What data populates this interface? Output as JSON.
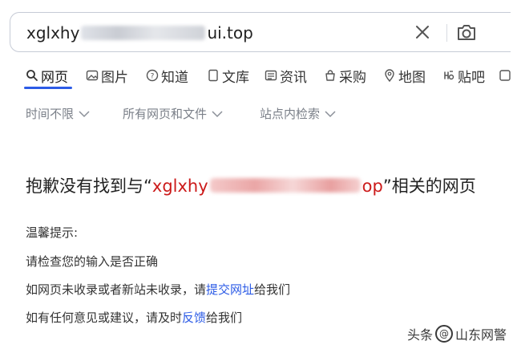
{
  "search": {
    "query_prefix": "xglxhy",
    "query_suffix": "ui.top"
  },
  "tabs": [
    {
      "label": "网页",
      "icon": "search-icon",
      "active": true
    },
    {
      "label": "图片",
      "icon": "image-icon"
    },
    {
      "label": "知道",
      "icon": "question-icon"
    },
    {
      "label": "文库",
      "icon": "document-icon"
    },
    {
      "label": "资讯",
      "icon": "news-icon"
    },
    {
      "label": "采购",
      "icon": "shopping-icon"
    },
    {
      "label": "地图",
      "icon": "map-pin-icon"
    },
    {
      "label": "贴吧",
      "icon": "tieba-icon"
    }
  ],
  "filters": [
    {
      "label": "时间不限"
    },
    {
      "label": "所有网页和文件"
    },
    {
      "label": "站点内检索"
    }
  ],
  "result": {
    "headline_prefix": "抱歉没有找到与“",
    "query_prefix": "xglxhy",
    "query_suffix": "op",
    "headline_suffix": "”相关的网页"
  },
  "tips": {
    "title": "温馨提示:",
    "line1": "请检查您的输入是否正确",
    "line2_prefix": "如网页未收录或者新站未收录，请",
    "line2_link": "提交网址",
    "line2_suffix": "给我们",
    "line3_prefix": "如有任何意见或建议，请及时",
    "line3_link": "反馈",
    "line3_suffix": "给我们"
  },
  "watermark": {
    "prefix": "头条",
    "at": "@",
    "account": "山东网警"
  },
  "colors": {
    "accent": "#2c5be6",
    "query_red": "#cc1a1a"
  }
}
